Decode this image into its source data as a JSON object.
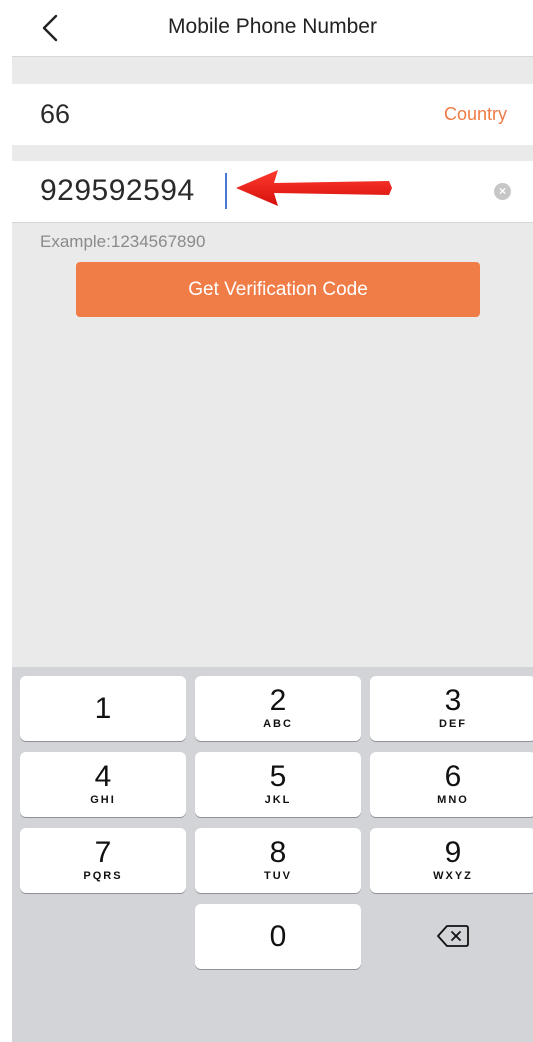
{
  "nav": {
    "title": "Mobile Phone Number",
    "back_icon": "chevron-left-icon"
  },
  "country": {
    "code": "66",
    "link_label": "Country",
    "accent_color": "#ef7b45"
  },
  "phone": {
    "value": "929592594",
    "clear_icon": "clear-x-icon",
    "annotation_icon": "red-arrow-icon"
  },
  "hint": {
    "example": "Example:1234567890"
  },
  "action": {
    "verify_label": "Get Verification Code",
    "button_color": "#f07d48"
  },
  "keypad": {
    "keys": [
      {
        "num": "1",
        "letters": ""
      },
      {
        "num": "2",
        "letters": "ABC"
      },
      {
        "num": "3",
        "letters": "DEF"
      },
      {
        "num": "4",
        "letters": "GHI"
      },
      {
        "num": "5",
        "letters": "JKL"
      },
      {
        "num": "6",
        "letters": "MNO"
      },
      {
        "num": "7",
        "letters": "PQRS"
      },
      {
        "num": "8",
        "letters": "TUV"
      },
      {
        "num": "9",
        "letters": "WXYZ"
      },
      {
        "num": "0",
        "letters": ""
      }
    ],
    "delete_icon": "backspace-icon"
  }
}
